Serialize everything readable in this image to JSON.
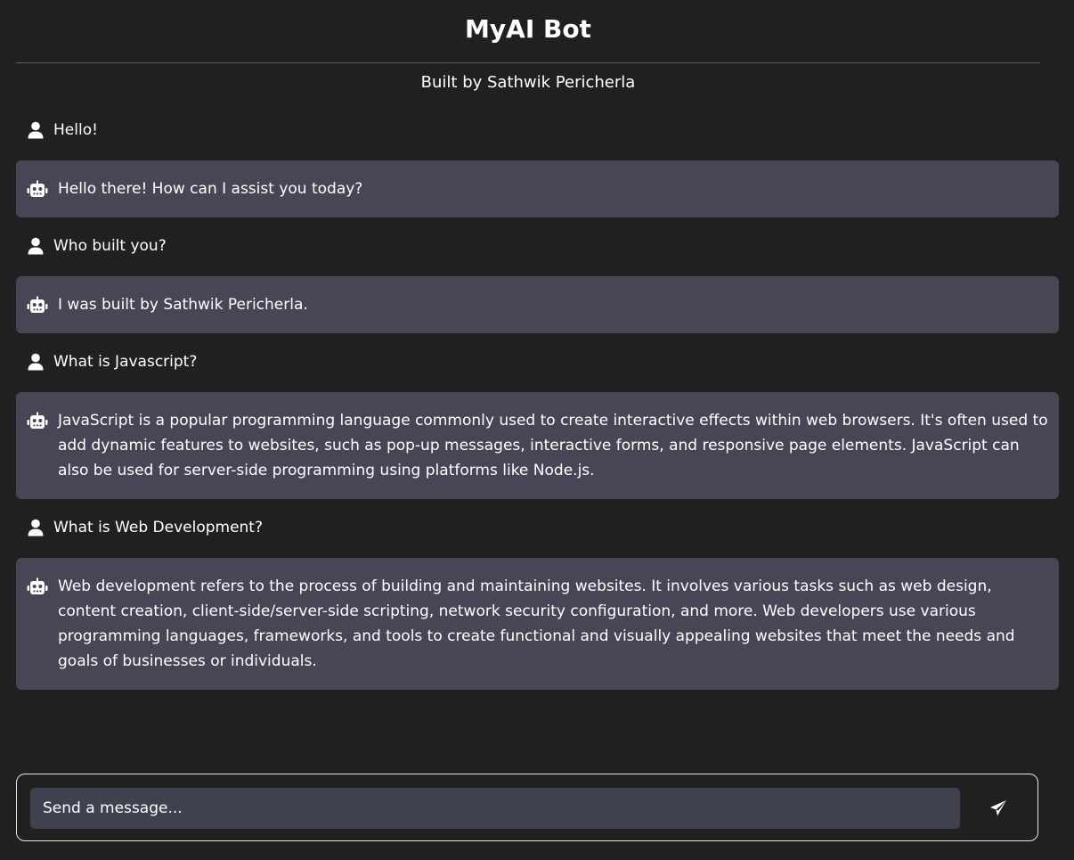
{
  "header": {
    "title": "MyAI Bot",
    "subtitle": "Built by Sathwik Pericherla"
  },
  "messages": [
    {
      "role": "user",
      "icon": "user-icon",
      "text": "Hello!"
    },
    {
      "role": "bot",
      "icon": "robot-icon",
      "text": "Hello there! How can I assist you today?"
    },
    {
      "role": "user",
      "icon": "user-icon",
      "text": "Who built you?"
    },
    {
      "role": "bot",
      "icon": "robot-icon",
      "text": "I was built by Sathwik Pericherla."
    },
    {
      "role": "user",
      "icon": "user-icon",
      "text": "What is Javascript?"
    },
    {
      "role": "bot",
      "icon": "robot-icon",
      "text": "JavaScript is a popular programming language commonly used to create interactive effects within web browsers. It's often used to add dynamic features to websites, such as pop-up messages, interactive forms, and responsive page elements. JavaScript can also be used for server-side programming using platforms like Node.js."
    },
    {
      "role": "user",
      "icon": "user-icon",
      "text": "What is Web Development?"
    },
    {
      "role": "bot",
      "icon": "robot-icon",
      "text": "Web development refers to the process of building and maintaining websites. It involves various tasks such as web design, content creation, client-side/server-side scripting, network security configuration, and more. Web developers use various programming languages, frameworks, and tools to create functional and visually appealing websites that meet the needs and goals of businesses or individuals."
    }
  ],
  "composer": {
    "placeholder": "Send a message...",
    "value": "",
    "send_icon": "paper-plane-icon"
  },
  "colors": {
    "background": "#202020",
    "bot_bubble": "#464655",
    "input_background": "#40414f",
    "text": "#ffffff"
  }
}
